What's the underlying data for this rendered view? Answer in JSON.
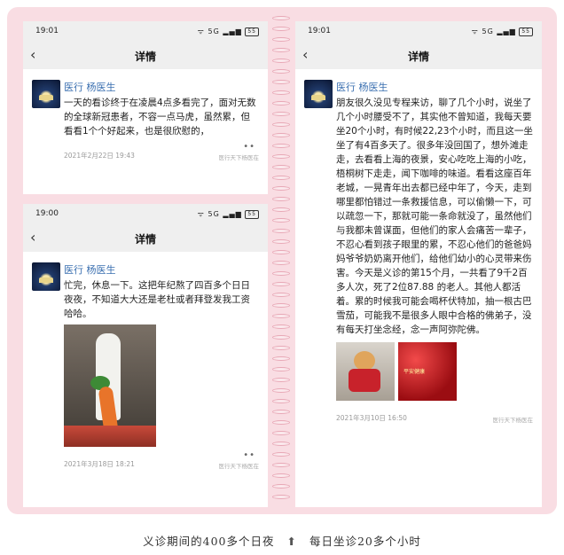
{
  "screens": [
    {
      "status": {
        "time": "19:01",
        "icons": "ᯤ 5G ▂▄▆",
        "battery": "55"
      },
      "nav": {
        "back_icon": "chevron-left-icon",
        "title": "详情"
      },
      "post": {
        "author": "医行 杨医生",
        "text": "一天的看诊终于在凌晨4点多看完了，面对无数的全球新冠患者，不容一点马虎，虽然累，但看看1个个好起来，也是很欣慰的，",
        "date": "2021年2月22日 19:43",
        "watermark": "医行天下杨医在",
        "more": "••"
      }
    },
    {
      "status": {
        "time": "19:00",
        "icons": "ᯤ 5G ▂▄▆",
        "battery": "55"
      },
      "nav": {
        "back_icon": "chevron-left-icon",
        "title": "详情"
      },
      "post": {
        "author": "医行 杨医生",
        "text": "忙完，休息一下。这把年纪熬了四百多个日日夜夜，不知道大大还是老杜或者拜登发我工资哈哈。",
        "date": "2021年3月18日 18:21",
        "watermark": "医行天下杨医在",
        "more": "••"
      }
    },
    {
      "status": {
        "time": "19:01",
        "icons": "ᯤ 5G ▂▄▆",
        "battery": "55"
      },
      "nav": {
        "back_icon": "chevron-left-icon",
        "title": "详情"
      },
      "post": {
        "author": "医行 杨医生",
        "text": "朋友很久没见专程来访，聊了几个小时，说坐了几个小时腰受不了，其实他不曾知道，我每天要坐20个小时，有时候22,23个小时，而且这一坐坐了有4百多天了。很多年没回国了，想外滩走走，去看看上海的夜景，安心吃吃上海的小吃，梧桐树下走走，闻下咖啡的味道。看看这座百年老城，一晃青年出去都已经中年了，今天，走到哪里都怕错过一条救援信息，可以偷懒一下，可以疏忽一下，那就可能一条命就没了，虽然他们与我都未曾谋面，但他们的家人会痛苦一辈子，不忍心看到孩子眼里的累，不忍心他们的爸爸妈妈爷爷奶奶离开他们，给他们幼小的心灵带来伤害。今天是义诊的第15个月，一共看了9千2百多人次，死了2位87.88 的老人。其他人都活着。累的时候我可能会喝杯伏特加，抽一根古巴雪茄，可能我不是很多人眼中合格的佛弟子，没有每天打坐念经，念一声阿弥陀佛。",
        "date": "2021年3月10日 16:50",
        "watermark": "医行天下杨医在",
        "photo_text": "平安健康"
      }
    }
  ],
  "caption": {
    "left": "义诊期间的400多个日夜",
    "separator": "⬆",
    "right": "每日坐诊20多个小时"
  }
}
